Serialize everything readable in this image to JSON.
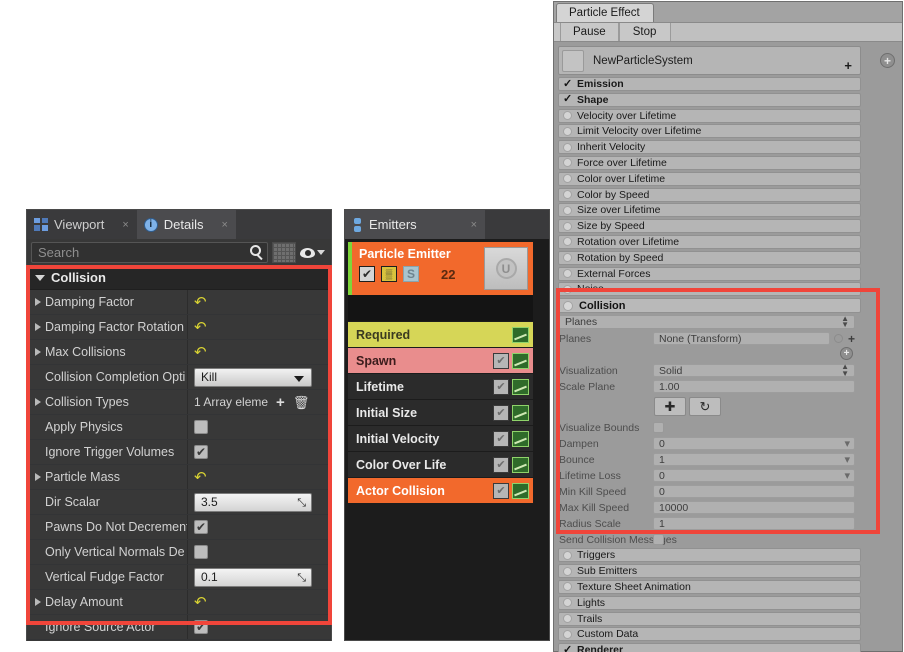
{
  "unreal": {
    "tabs": [
      {
        "label": "Viewport",
        "icon": "viewport-icon",
        "close": "×",
        "active": false
      },
      {
        "label": "Details",
        "icon": "details-info-icon",
        "close": "×",
        "active": true
      }
    ],
    "search": {
      "placeholder": "Search",
      "icon": "search-magnifier-icon"
    },
    "toolbar": {
      "grid_icon": "grid-view-icon",
      "eye_icon": "eye-visibility-icon",
      "caret_icon": "chevron-down-icon"
    },
    "category": {
      "label": "Collision",
      "expanded": true
    },
    "properties": [
      {
        "label": "Damping Factor",
        "expandable": true,
        "type": "revert",
        "value": "↶"
      },
      {
        "label": "Damping Factor Rotation",
        "expandable": true,
        "type": "revert",
        "value": "↶"
      },
      {
        "label": "Max Collisions",
        "expandable": true,
        "type": "revert",
        "value": "↶"
      },
      {
        "label": "Collision Completion Opti",
        "expandable": false,
        "type": "combo",
        "value": "Kill"
      },
      {
        "label": "Collision Types",
        "expandable": true,
        "type": "array",
        "value": "1 Array eleme",
        "add": "+",
        "delete": "🗑"
      },
      {
        "label": "Apply Physics",
        "expandable": false,
        "type": "checkbox",
        "checked": false
      },
      {
        "label": "Ignore Trigger Volumes",
        "expandable": false,
        "type": "checkbox",
        "checked": true
      },
      {
        "label": "Particle Mass",
        "expandable": true,
        "type": "revert",
        "value": "↶"
      },
      {
        "label": "Dir Scalar",
        "expandable": false,
        "type": "number",
        "value": "3.5"
      },
      {
        "label": "Pawns Do Not Decrement",
        "expandable": false,
        "type": "checkbox",
        "checked": true
      },
      {
        "label": "Only Vertical Normals De",
        "expandable": false,
        "type": "checkbox",
        "checked": false
      },
      {
        "label": "Vertical Fudge Factor",
        "expandable": false,
        "type": "number",
        "value": "0.1"
      },
      {
        "label": "Delay Amount",
        "expandable": true,
        "type": "revert",
        "value": "↶"
      },
      {
        "label": "Ignore Source Actor",
        "expandable": false,
        "type": "checkbox",
        "checked": true
      }
    ]
  },
  "emitters": {
    "tab": {
      "label": "Emitters",
      "icon": "emitters-icon",
      "close": "×"
    },
    "emitter": {
      "name": "Particle Emitter",
      "count": "22",
      "badges": [
        {
          "name": "enabled-checkbox",
          "glyph": "✔"
        },
        {
          "name": "render-mode-badge",
          "glyph": "▒"
        },
        {
          "name": "solo-badge",
          "glyph": "S"
        }
      ],
      "thumbnail": "unreal-logo-thumbnail"
    },
    "modules": [
      {
        "label": "Required",
        "style": "required",
        "checkbox": false,
        "graph": true
      },
      {
        "label": "Spawn",
        "style": "spawn",
        "checkbox": true,
        "graph": true
      },
      {
        "label": "Lifetime",
        "style": "plain",
        "checkbox": true,
        "graph": true
      },
      {
        "label": "Initial Size",
        "style": "plain",
        "checkbox": true,
        "graph": true
      },
      {
        "label": "Initial Velocity",
        "style": "plain",
        "checkbox": true,
        "graph": true
      },
      {
        "label": "Color Over Life",
        "style": "plain",
        "checkbox": true,
        "graph": true
      },
      {
        "label": "Actor Collision",
        "style": "actor",
        "checkbox": true,
        "graph": true
      }
    ]
  },
  "unity": {
    "tab": {
      "label": "Particle Effect"
    },
    "toolbar_buttons": [
      {
        "label": "Pause"
      },
      {
        "label": "Stop"
      }
    ],
    "system": {
      "name": "NewParticleSystem",
      "plus": "+",
      "add_icon": "add-circle-icon"
    },
    "modules": [
      {
        "label": "Emission",
        "state": "checked"
      },
      {
        "label": "Shape",
        "state": "checked"
      },
      {
        "label": "Velocity over Lifetime",
        "state": "off"
      },
      {
        "label": "Limit Velocity over Lifetime",
        "state": "off"
      },
      {
        "label": "Inherit Velocity",
        "state": "off"
      },
      {
        "label": "Force over Lifetime",
        "state": "off"
      },
      {
        "label": "Color over Lifetime",
        "state": "off"
      },
      {
        "label": "Color by Speed",
        "state": "off"
      },
      {
        "label": "Size over Lifetime",
        "state": "off"
      },
      {
        "label": "Size by Speed",
        "state": "off"
      },
      {
        "label": "Rotation over Lifetime",
        "state": "off"
      },
      {
        "label": "Rotation by Speed",
        "state": "off"
      },
      {
        "label": "External Forces",
        "state": "off"
      },
      {
        "label": "Noise",
        "state": "off"
      }
    ],
    "collision": {
      "header": "Collision",
      "mode": "Planes",
      "planes_label": "Planes",
      "planes_value": "None (Transform)",
      "visualization_label": "Visualization",
      "visualization_value": "Solid",
      "scale_plane_label": "Scale Plane",
      "scale_plane_value": "1.00",
      "move_tool_icon": "move-gizmo-icon",
      "rotate_tool_icon": "rotate-gizmo-icon",
      "fields": [
        {
          "label": "Visualize Bounds",
          "type": "checkbox",
          "value": ""
        },
        {
          "label": "Dampen",
          "type": "number-curve",
          "value": "0"
        },
        {
          "label": "Bounce",
          "type": "number-curve",
          "value": "1"
        },
        {
          "label": "Lifetime Loss",
          "type": "number-curve",
          "value": "0"
        },
        {
          "label": "Min Kill Speed",
          "type": "number",
          "value": "0"
        },
        {
          "label": "Max Kill Speed",
          "type": "number",
          "value": "10000"
        },
        {
          "label": "Radius Scale",
          "type": "number",
          "value": "1"
        },
        {
          "label": "Send Collision Messages",
          "type": "checkbox",
          "value": ""
        }
      ]
    },
    "modules_after": [
      {
        "label": "Triggers",
        "state": "off"
      },
      {
        "label": "Sub Emitters",
        "state": "off"
      },
      {
        "label": "Texture Sheet Animation",
        "state": "off"
      },
      {
        "label": "Lights",
        "state": "off"
      },
      {
        "label": "Trails",
        "state": "off"
      },
      {
        "label": "Custom Data",
        "state": "off"
      },
      {
        "label": "Renderer",
        "state": "checked"
      }
    ]
  },
  "annotations": {
    "highlight_color": "#f0453a",
    "boxes": [
      {
        "name": "unreal-collision-highlight"
      },
      {
        "name": "unity-collision-highlight"
      }
    ]
  }
}
